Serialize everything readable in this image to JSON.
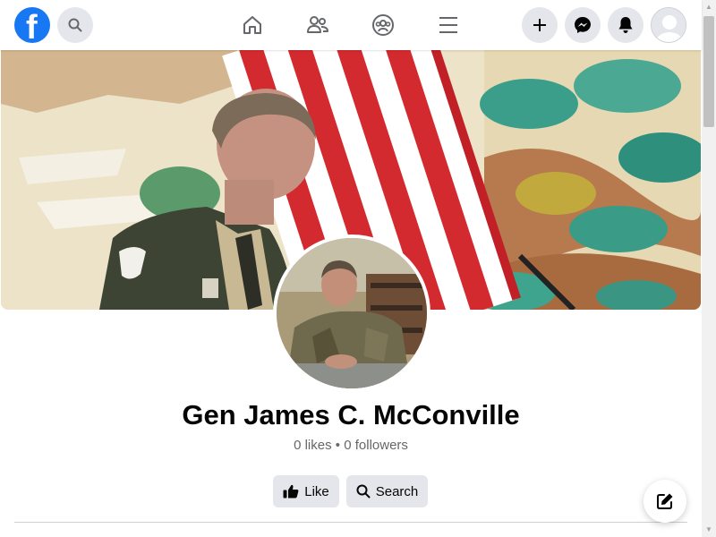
{
  "header": {
    "logo_letter": "f",
    "icons": [
      "facebook-logo",
      "search-icon",
      "home-icon",
      "friends-icon",
      "groups-icon",
      "menu-icon",
      "plus-icon",
      "messenger-icon",
      "bell-icon",
      "avatar"
    ]
  },
  "profile": {
    "name": "Gen James C. McConville",
    "likes": "0 likes",
    "separator": "•",
    "followers": "0 followers"
  },
  "actions": {
    "like_label": "Like",
    "search_label": "Search"
  },
  "colors": {
    "brand": "#1877F2",
    "button_bg": "#e4e6eb",
    "text_secondary": "#65676b"
  }
}
